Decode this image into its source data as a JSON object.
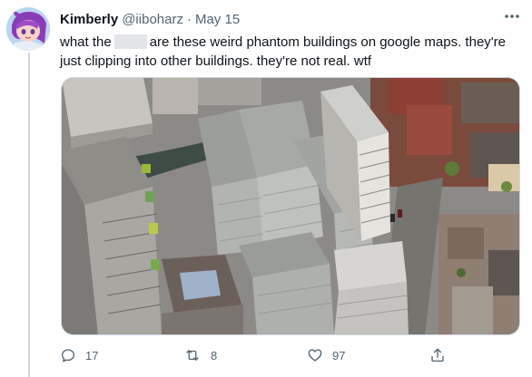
{
  "tweet": {
    "author_name": "Kimberly",
    "handle": "@iiboharz",
    "separator": "·",
    "date": "May 15",
    "text_before": "what the",
    "text_after": "are these weird phantom buildings on google maps. they're just clipping into other buildings. they're not real. wtf"
  },
  "actions": {
    "reply_count": "17",
    "retweet_count": "8",
    "like_count": "97"
  },
  "icons": {
    "more": "more-horizontal-icon",
    "reply": "reply-icon",
    "retweet": "retweet-icon",
    "like": "heart-icon",
    "share": "share-icon"
  },
  "colors": {
    "text": "#0f1419",
    "secondary": "#536471",
    "border": "#cfd9de"
  }
}
